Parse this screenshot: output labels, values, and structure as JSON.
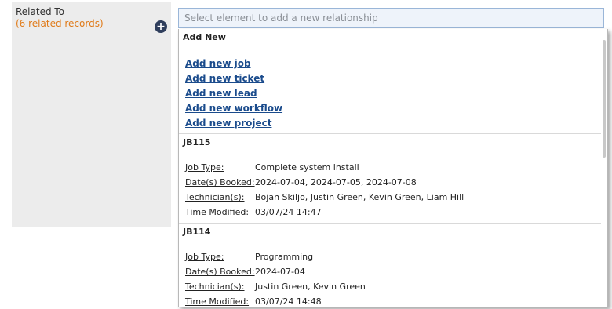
{
  "related": {
    "title": "Related To",
    "count_label": "(6 related records)",
    "add_icon": "plus-circle-icon"
  },
  "search": {
    "placeholder": "Select element to add a new relationship"
  },
  "dropdown": {
    "add_new_header": "Add New",
    "add_links": [
      "Add new job",
      "Add new ticket",
      "Add new lead",
      "Add new workflow",
      "Add new project"
    ],
    "records": [
      {
        "id": "JB115",
        "fields": [
          {
            "label": "Job Type:",
            "value": "Complete system install"
          },
          {
            "label": "Date(s) Booked:",
            "value": "2024-07-04, 2024-07-05, 2024-07-08"
          },
          {
            "label": "Technician(s):",
            "value": "Bojan Skiljo, Justin Green, Kevin Green, Liam Hill"
          },
          {
            "label": "Time Modified:",
            "value": "03/07/24 14:47"
          }
        ]
      },
      {
        "id": "JB114",
        "fields": [
          {
            "label": "Job Type:",
            "value": "Programming"
          },
          {
            "label": "Date(s) Booked:",
            "value": "2024-07-04"
          },
          {
            "label": "Technician(s):",
            "value": "Justin Green, Kevin Green"
          },
          {
            "label": "Time Modified:",
            "value": "03/07/24 14:48"
          }
        ]
      }
    ]
  },
  "colors": {
    "accent_orange": "#e07b1a",
    "link_blue": "#1a4b8c",
    "icon_navy": "#2f3e5c"
  }
}
